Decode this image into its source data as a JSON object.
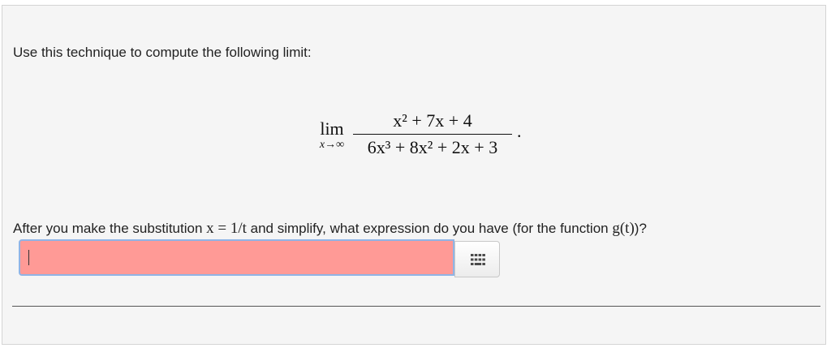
{
  "problem": {
    "instruction": "Use this technique to compute the following limit:",
    "limit_word": "lim",
    "limit_subscript": "x→∞",
    "numerator": "x² + 7x + 4",
    "denominator": "6x³ + 8x² + 2x + 3",
    "period": "."
  },
  "question": {
    "part1": "After you make the substitution ",
    "math1": "x = 1/t",
    "part2": " and simplify, what expression do you have (for the function ",
    "math2": "g(t)",
    "part3": ")?"
  },
  "answer": {
    "value": "",
    "status_color": "#ff9a96",
    "focus_border_color": "#8fb4e6"
  },
  "keypad": {
    "icon": "keypad-icon"
  }
}
